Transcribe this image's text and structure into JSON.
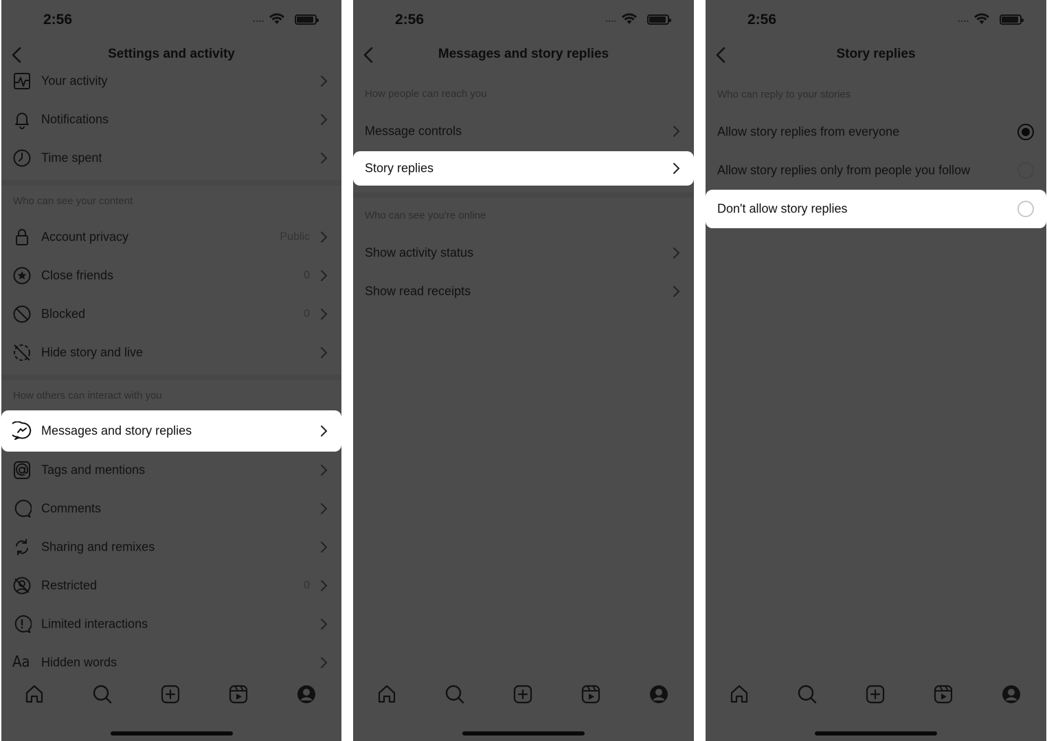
{
  "status_bar": {
    "time": "2:56",
    "signal_dots": "••••"
  },
  "screen1": {
    "title": "Settings and activity",
    "top_rows": [
      {
        "label": "Your activity",
        "icon": "activity-icon"
      },
      {
        "label": "Notifications",
        "icon": "bell-icon"
      },
      {
        "label": "Time spent",
        "icon": "clock-icon"
      }
    ],
    "section_content": "Who can see your content",
    "content_rows": [
      {
        "label": "Account privacy",
        "value": "Public",
        "icon": "lock-icon"
      },
      {
        "label": "Close friends",
        "value": "0",
        "icon": "star-circle-icon"
      },
      {
        "label": "Blocked",
        "value": "0",
        "icon": "blocked-icon"
      },
      {
        "label": "Hide story and live",
        "icon": "hide-story-icon"
      }
    ],
    "section_interact": "How others can interact with you",
    "interact_rows": [
      {
        "label": "Messages and story replies",
        "icon": "messenger-icon",
        "highlighted": true
      },
      {
        "label": "Tags and mentions",
        "icon": "at-icon"
      },
      {
        "label": "Comments",
        "icon": "comment-icon"
      },
      {
        "label": "Sharing and remixes",
        "icon": "remix-icon"
      },
      {
        "label": "Restricted",
        "value": "0",
        "icon": "restricted-icon"
      },
      {
        "label": "Limited interactions",
        "icon": "alert-circle-icon"
      },
      {
        "label": "Hidden words",
        "icon": "text-aa-icon",
        "icon_text": "Aa"
      }
    ]
  },
  "screen2": {
    "title": "Messages and story replies",
    "section_reach": "How people can reach you",
    "reach_rows": [
      {
        "label": "Message controls"
      },
      {
        "label": "Story replies",
        "highlighted": true
      }
    ],
    "section_online": "Who can see you're online",
    "online_rows": [
      {
        "label": "Show activity status"
      },
      {
        "label": "Show read receipts"
      }
    ]
  },
  "screen3": {
    "title": "Story replies",
    "section": "Who can reply to your stories",
    "options": [
      {
        "label": "Allow story replies from everyone",
        "selected": true
      },
      {
        "label": "Allow story replies only from people you follow",
        "selected": false
      },
      {
        "label": "Don't allow story replies",
        "selected": false,
        "highlighted": true
      }
    ]
  },
  "tabbar": [
    "home-icon",
    "search-icon",
    "create-icon",
    "reels-icon",
    "profile-icon"
  ],
  "colors": {
    "dim_background": "#4c4c4c",
    "highlight": "#ffffff",
    "text": "#111111"
  }
}
